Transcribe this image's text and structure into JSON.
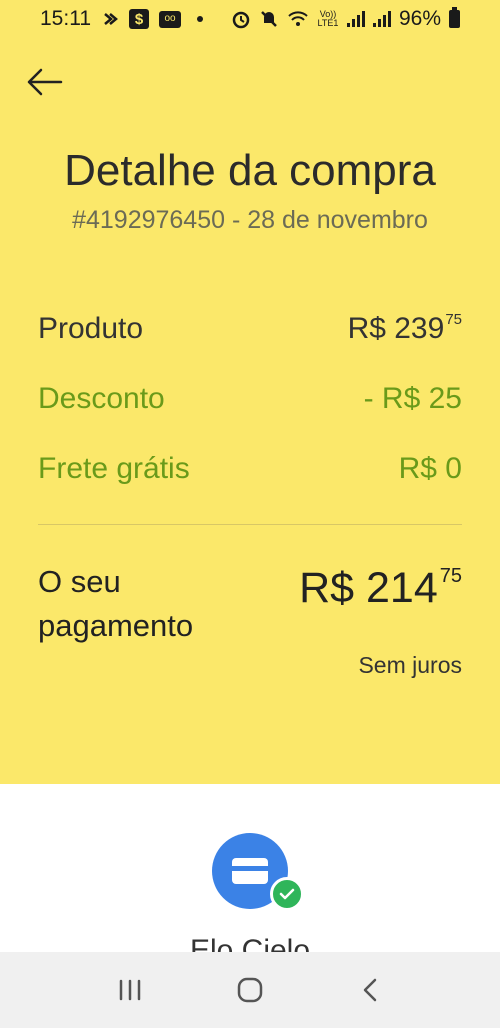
{
  "status_bar": {
    "time": "15:11",
    "battery": "96%",
    "volte": "Vo)) LTE1",
    "icons": [
      "bolt-icon",
      "dollar-app-icon",
      "voicemail-icon",
      "dot-icon",
      "alarm-icon",
      "mute-icon",
      "wifi-icon",
      "signal-icon",
      "battery-icon"
    ]
  },
  "header": {
    "back_icon": "arrow-left-icon",
    "title": "Detalhe da compra",
    "subtitle": "#4192976450 - 28 de novembro"
  },
  "summary": {
    "product": {
      "label": "Produto",
      "value": "R$ 239",
      "cents": "75"
    },
    "discount": {
      "label": "Desconto",
      "value": "- R$ 25"
    },
    "shipping": {
      "label": "Frete grátis",
      "value": "R$ 0"
    }
  },
  "payment": {
    "label": "O seu pagamento",
    "value": "R$ 214",
    "cents": "75",
    "note": "Sem juros"
  },
  "card": {
    "icon": "credit-card-icon",
    "badge_icon": "check-icon",
    "name": "Elo Cielo"
  },
  "nav": {
    "recents_icon": "recents-icon",
    "home_icon": "home-icon",
    "back_icon": "back-chevron-icon"
  },
  "colors": {
    "header_bg": "#fbe86a",
    "discount_green": "#6a9a1a",
    "card_blue": "#3b82e6",
    "check_green": "#2fb55a"
  }
}
